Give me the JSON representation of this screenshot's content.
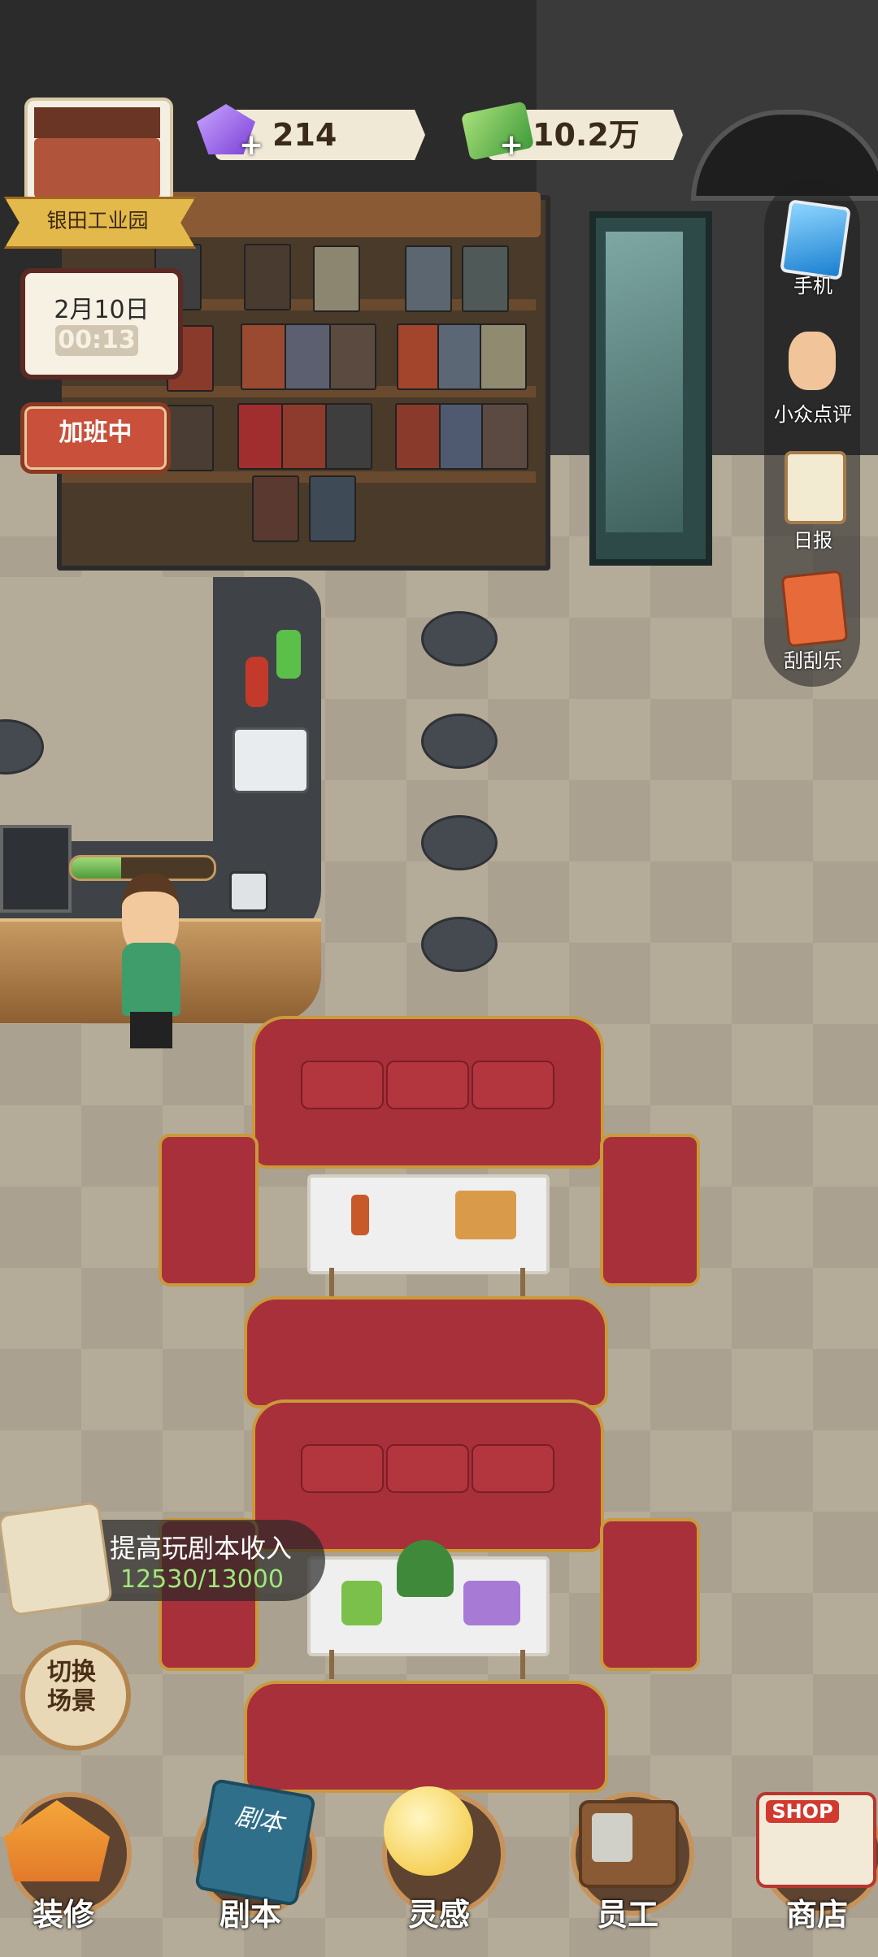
{
  "location": {
    "name": "银田工业园"
  },
  "resources": {
    "gems": {
      "value": "214",
      "icon": "gem-icon",
      "color": "#8b55e6"
    },
    "cash": {
      "value": "10.2万",
      "icon": "cash-icon",
      "color": "#4fa33f"
    }
  },
  "calendar": {
    "date": "2月10日",
    "time": "00:13"
  },
  "status": {
    "label": "加班中"
  },
  "side_menu": [
    {
      "label": "手机",
      "icon": "phone-icon"
    },
    {
      "label": "小众点评",
      "icon": "thumbs-up-icon"
    },
    {
      "label": "日报",
      "icon": "clipboard-icon"
    },
    {
      "label": "刮刮乐",
      "icon": "lottery-ticket-icon"
    }
  ],
  "work_progress": {
    "fraction": 0.35
  },
  "quest": {
    "title": "提高玩剧本收入",
    "progress": "12530/13000"
  },
  "switch_scene": {
    "label": "切换\n场景"
  },
  "bottom_nav": [
    {
      "label": "装修",
      "icon": "house-icon"
    },
    {
      "label": "剧本",
      "icon": "script-book-icon"
    },
    {
      "label": "灵感",
      "icon": "lightbulb-icon"
    },
    {
      "label": "员工",
      "icon": "staff-badge-icon"
    },
    {
      "label": "商店",
      "icon": "shop-icon"
    }
  ],
  "icons": {
    "book_cover": "剧本",
    "shop_sign": "SHOP"
  }
}
